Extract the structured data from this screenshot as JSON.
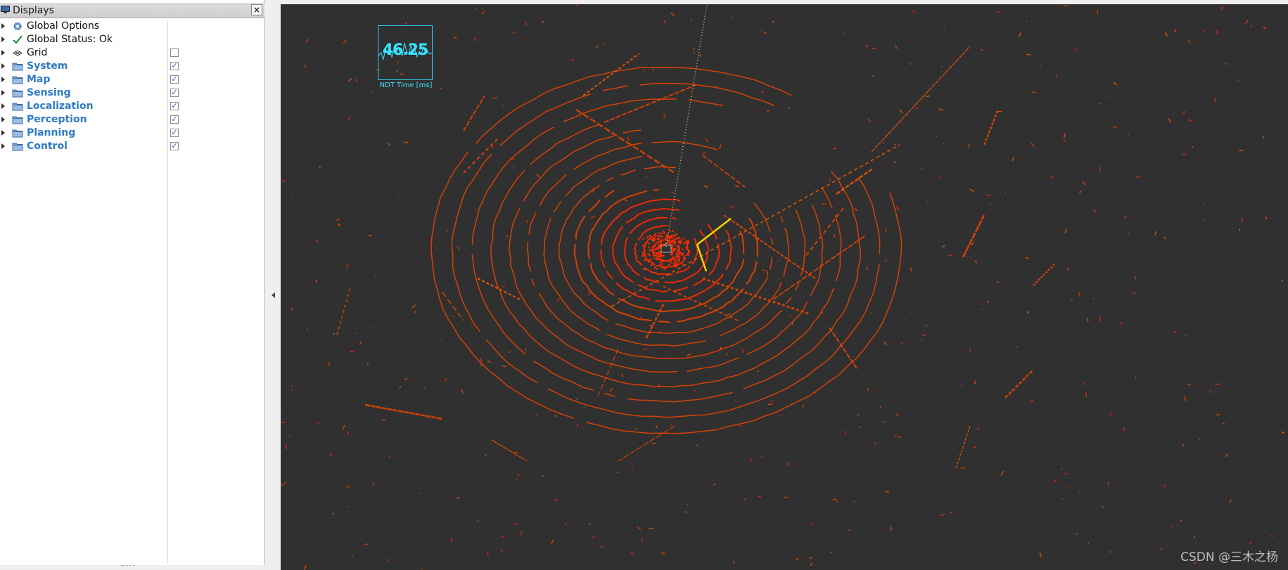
{
  "displays_panel": {
    "title": "Displays",
    "items": [
      {
        "label": "Global Options",
        "icon": "gear-icon",
        "group": false,
        "checkbox": null
      },
      {
        "label": "Global Status: Ok",
        "icon": "checkmark-icon",
        "group": false,
        "checkbox": null
      },
      {
        "label": "Grid",
        "icon": "grid-icon",
        "group": false,
        "checkbox": false
      },
      {
        "label": "System",
        "icon": "folder-icon",
        "group": true,
        "checkbox": true
      },
      {
        "label": "Map",
        "icon": "folder-icon",
        "group": true,
        "checkbox": true
      },
      {
        "label": "Sensing",
        "icon": "folder-icon",
        "group": true,
        "checkbox": true
      },
      {
        "label": "Localization",
        "icon": "folder-icon",
        "group": true,
        "checkbox": true
      },
      {
        "label": "Perception",
        "icon": "folder-icon",
        "group": true,
        "checkbox": true
      },
      {
        "label": "Planning",
        "icon": "folder-icon",
        "group": true,
        "checkbox": true
      },
      {
        "label": "Control",
        "icon": "folder-icon",
        "group": true,
        "checkbox": true
      }
    ]
  },
  "viewport": {
    "ndt_overlay": {
      "value": "46.25",
      "label": "NDT Time [ms]",
      "color": "#38e4ff"
    },
    "pointcloud_colors": [
      "#ff2a00",
      "#ff5a00",
      "#e84400",
      "#ffd200"
    ],
    "background": "#303030"
  },
  "watermark": "CSDN @三木之杨"
}
